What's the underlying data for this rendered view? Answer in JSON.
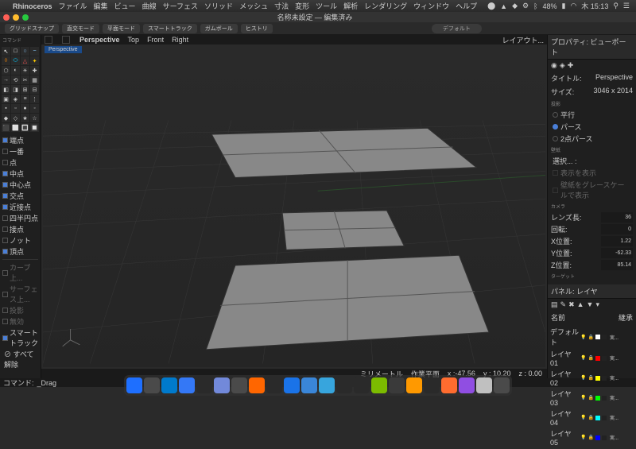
{
  "mac_menu": {
    "app": "Rhinoceros",
    "items": [
      "ファイル",
      "編集",
      "ビュー",
      "曲線",
      "サーフェス",
      "ソリッド",
      "メッシュ",
      "寸法",
      "変形",
      "ツール",
      "解析",
      "レンダリング",
      "ウィンドウ",
      "ヘルプ"
    ]
  },
  "mac_status": {
    "battery": "48%",
    "time": "木 15:13"
  },
  "title": {
    "name": "名称未設定",
    "status": "— 編集済み"
  },
  "toolbar": [
    "グリッドスナップ",
    "直交モード",
    "平面モード",
    "スマートトラック",
    "ガムボール",
    "ヒストリ"
  ],
  "toolbar_default": "デフォルト",
  "viewtabs": [
    "Perspective",
    "Top",
    "Front",
    "Right"
  ],
  "viewport_label": "Perspective",
  "layout_label": "レイアウト...",
  "osnap": {
    "items": [
      {
        "label": "端点",
        "on": true
      },
      {
        "label": "一番",
        "on": false
      },
      {
        "label": "点",
        "on": false
      },
      {
        "label": "中点",
        "on": true
      },
      {
        "label": "中心点",
        "on": true
      },
      {
        "label": "交点",
        "on": true
      },
      {
        "label": "近接点",
        "on": true
      },
      {
        "label": "四半円点",
        "on": false
      },
      {
        "label": "接点",
        "on": false
      },
      {
        "label": "ノット",
        "on": false
      },
      {
        "label": "頂点",
        "on": true
      }
    ],
    "lower": [
      {
        "label": "カーブ上...",
        "on": false
      },
      {
        "label": "サーフェス上...",
        "on": false
      },
      {
        "label": "投影",
        "on": false
      },
      {
        "label": "無効",
        "on": false
      },
      {
        "label": "スマートトラック",
        "on": true
      }
    ],
    "clear": "すべて解除"
  },
  "props": {
    "title": "プロパティ: ビューポート",
    "name_lbl": "タイトル:",
    "name": "Perspective",
    "size_lbl": "サイズ:",
    "size": "3046 x 2014",
    "proj_lbl": "投影",
    "proj": [
      {
        "label": "平行",
        "on": false
      },
      {
        "label": "パース",
        "on": true
      },
      {
        "label": "2点パース",
        "on": false
      }
    ],
    "lock_lbl": "壁紙",
    "sel": "選択... :",
    "show": "表示を表示",
    "gray": "壁紙をグレースケールで表示",
    "cam_lbl": "カメラ",
    "lens_lbl": "レンズ長:",
    "lens": "36",
    "rot_lbl": "回転:",
    "rot": "0",
    "x_lbl": "X位置:",
    "x": "1.22",
    "y_lbl": "Y位置:",
    "y": "-62.33",
    "z_lbl": "Z位置:",
    "z": "85.14",
    "target_lbl": "ターゲット"
  },
  "layers": {
    "title": "パネル: レイヤ",
    "head": [
      "名前",
      "",
      "",
      "継承"
    ],
    "rows": [
      {
        "name": "デフォルト",
        "color": "#ffffff"
      },
      {
        "name": "レイヤ 01",
        "color": "#ff0000"
      },
      {
        "name": "レイヤ 02",
        "color": "#ffff00"
      },
      {
        "name": "レイヤ 03",
        "color": "#00ff00"
      },
      {
        "name": "レイヤ 04",
        "color": "#00ffff"
      },
      {
        "name": "レイヤ 05",
        "color": "#0000ff"
      }
    ]
  },
  "status": {
    "mm": "ミリメートル",
    "cplane": "作業平面",
    "x": "x :-47.56",
    "y": "y : 10.20",
    "z": "z : 0.00"
  },
  "command": {
    "lbl": "コマンド:",
    "val": "_Drag"
  },
  "dock_colors": [
    "#1e6fff",
    "#4a4a4a",
    "#007ACC",
    "#3478f6",
    "#2a2a2a",
    "#7289da",
    "#4a4a4a",
    "#ff6600",
    "#2a2a2a",
    "#1a73e8",
    "#3a86d8",
    "#37a5dd",
    "#2a2a2a",
    "#2a2a2a",
    "#7cbb00",
    "#3a3a3a",
    "#ff9900",
    "#2a2a2a",
    "#ff6c2f",
    "#904ee2",
    "#c0c0c0",
    "#4a4a4a"
  ],
  "tool_icons": [
    "↖",
    "□",
    "○",
    "~",
    "◊",
    "⬭",
    "△",
    "✦",
    "⬡",
    "◐",
    "☀",
    "✚",
    "→",
    "⟲",
    "✂",
    "▦",
    "◧",
    "◨",
    "⊞",
    "⊟",
    "▣",
    "◈",
    "≡",
    "⋮",
    "▪",
    "▫",
    "●",
    "◦",
    "◆",
    "◇",
    "★",
    "☆",
    "⬛",
    "⬜",
    "🔳",
    "🔲"
  ]
}
